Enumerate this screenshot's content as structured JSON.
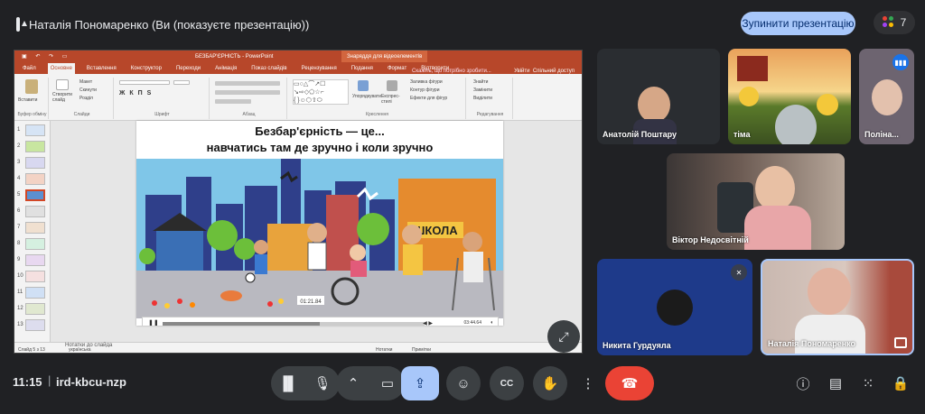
{
  "meeting": {
    "presenter_label": "Наталія Пономаренко (Ви (показуєте презентацію))",
    "stop_button": "Зупинити презентацію",
    "participants_count": "7",
    "time": "11:15",
    "code": "ird-kbcu-nzp"
  },
  "ppt": {
    "doc_title": "БЕЗБАР'ЄРНІСТЬ - PowerPoint",
    "context_tab": "Знаряддя для відеоелементів",
    "tabs": [
      "Файл",
      "Основне",
      "Вставлення",
      "Конструктор",
      "Переходи",
      "Анімація",
      "Показ слайдів",
      "Рецензування",
      "Подання",
      "Формат",
      "Відтворити"
    ],
    "search_hint": "Скажіть, що потрібно зробити...",
    "sign_in": "Увійти",
    "share": "Спільний доступ",
    "ribbon_groups": [
      "Буфер обміну",
      "Слайди",
      "Шрифт",
      "Абзац",
      "Креслення",
      "Редагування"
    ],
    "ribbon_items": {
      "paste": "Вставити",
      "new_slide": "Створити слайд",
      "layout": "Макет",
      "reset": "Скинути",
      "section": "Розділ",
      "arrange": "Упорядкувати",
      "quick_styles": "Експрес-стилі",
      "fill": "Заливка фігури",
      "outline": "Контур фігури",
      "effects": "Ефекти для фігур",
      "find": "Знайти",
      "replace": "Замінити",
      "select": "Виділити"
    },
    "slide_title_1": "Безбар'єрність — це...",
    "slide_title_2": "навчатись там де зручно і коли зручно",
    "school_sign": "ШКОЛА",
    "video_current": "01:21.84",
    "video_total": "03:44.64",
    "notes_label": "Нотатки до слайда",
    "status_slide": "Слайд 5 з 13",
    "status_lang": "українська",
    "status_notes": "Нотатки",
    "status_comments": "Примітки",
    "thumb_numbers": [
      "1",
      "2",
      "3",
      "4",
      "5",
      "6",
      "7",
      "8",
      "9",
      "10",
      "11",
      "12",
      "13"
    ]
  },
  "participants": [
    {
      "name": "Анатолій Поштару"
    },
    {
      "name": "тіма"
    },
    {
      "name": "Поліна..."
    },
    {
      "name": "Віктор Недосвітній"
    },
    {
      "name": "Никита Гурдуяла"
    },
    {
      "name": "Наталія Пономаренко"
    }
  ],
  "colors": {
    "background": "#202124",
    "accent": "#a8c7fa",
    "ppt_red": "#b7472a",
    "end_call": "#ea4335",
    "tile_blue": "#1e3a8a"
  },
  "icons": {
    "present": "present-to-all-icon",
    "captions": "captions-icon",
    "mic": "mic-icon",
    "camera": "camera-icon"
  }
}
